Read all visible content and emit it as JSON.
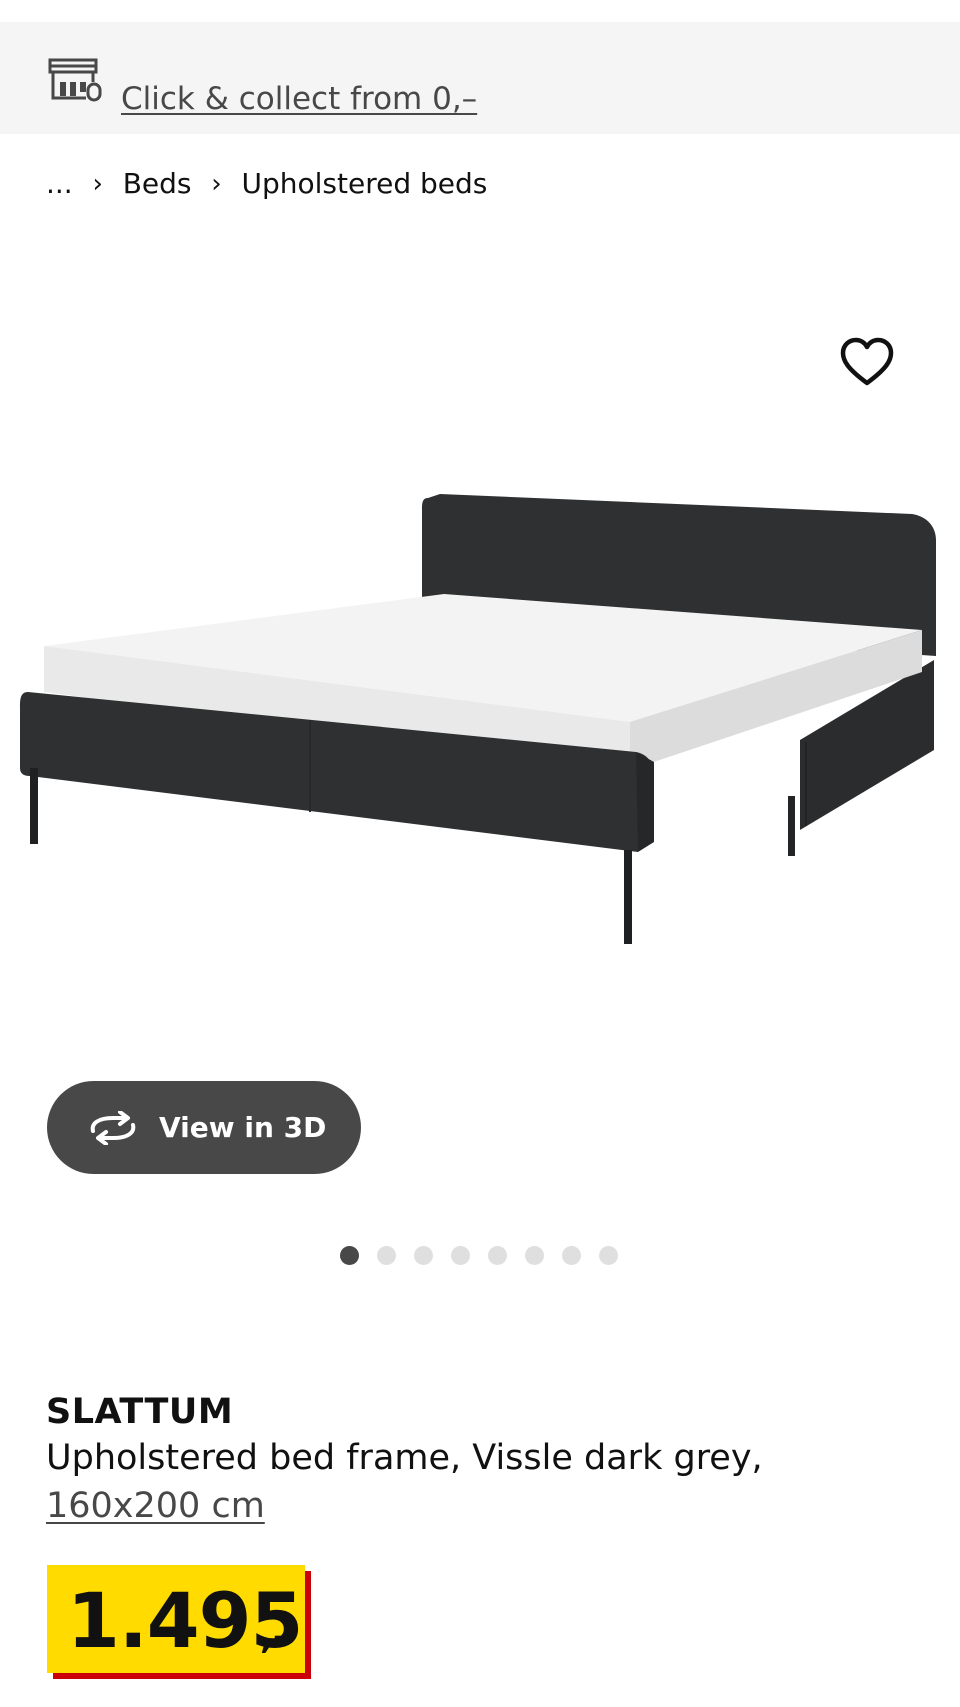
{
  "banner": {
    "icon": "store-collect-icon",
    "text": "Click & collect from 0,–"
  },
  "breadcrumb": {
    "items": [
      "...",
      "Beds",
      "Upholstered beds"
    ],
    "separator_icon": "chevron-right-icon"
  },
  "gallery": {
    "favourite_icon": "heart-icon",
    "image_alt": "SLATTUM upholstered bed frame in dark grey with white mattress",
    "view3d": {
      "icon": "rotate-3d-icon",
      "label": "View in 3D"
    },
    "slide_count": 8,
    "active_slide": 1
  },
  "product": {
    "name": "SLATTUM",
    "description": "Upholstered bed frame, Vissle dark grey,",
    "size": "160x200 cm",
    "price": {
      "integer": "1.495",
      "suffix": ",-"
    }
  },
  "colors": {
    "banner_bg": "#f5f5f5",
    "price_bg": "#ffdb00",
    "price_shadow": "#cc0008",
    "button_bg": "#484848",
    "bed_fabric": "#2f3031"
  }
}
